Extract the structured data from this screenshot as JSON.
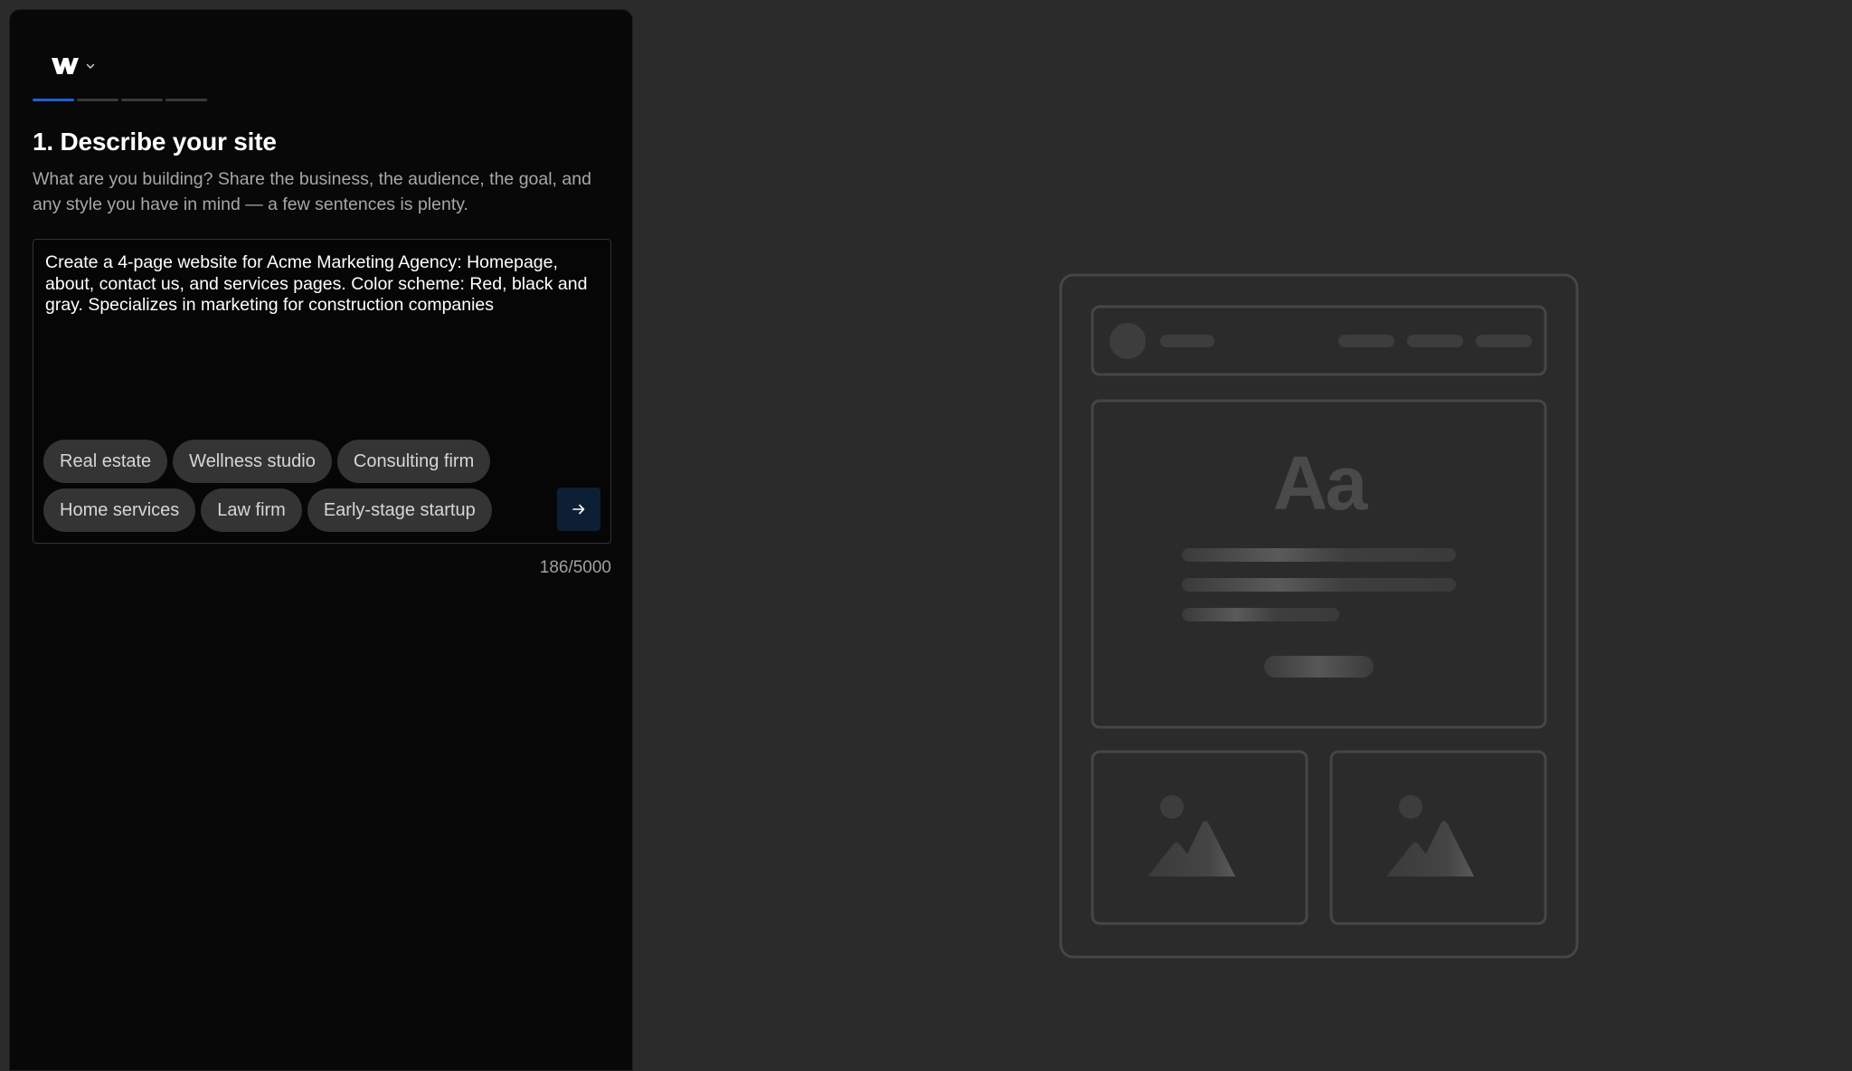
{
  "app": {
    "logo_icon": "webflow-logo-icon",
    "logo_menu_icon": "chevron-down-icon"
  },
  "progress": {
    "total_steps": 4,
    "current_step": 1
  },
  "step": {
    "title": "1. Describe your site",
    "subtitle": "What are you building? Share the business, the audience, the goal, and any style you have in mind — a few sentences is plenty."
  },
  "composer": {
    "prompt_value": "Create a 4-page website for Acme Marketing Agency: Homepage, about, contact us, and services pages. Color scheme: Red, black and gray. Specializes in marketing for construction companies",
    "suggestions_row1": [
      "Real estate",
      "Wellness studio",
      "Consulting firm"
    ],
    "suggestions_row2": [
      "Home services",
      "Law firm",
      "Early-stage startup"
    ],
    "submit_icon": "arrow-right-icon",
    "char_count": "186/5000"
  },
  "preview": {
    "typography_sample": "Aa",
    "image_icon": "image-placeholder-icon"
  },
  "colors": {
    "panel_bg": "#080808",
    "page_bg": "#2b2b2b",
    "accent": "#1e5fd8",
    "chip_bg": "#343434",
    "submit_bg": "#0d1f33"
  }
}
